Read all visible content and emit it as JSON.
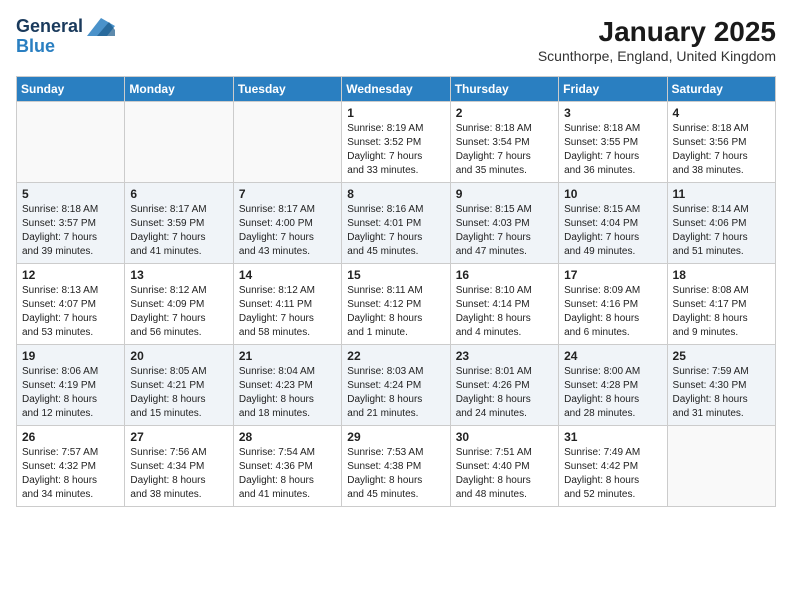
{
  "header": {
    "logo_line1": "General",
    "logo_line2": "Blue",
    "title": "January 2025",
    "subtitle": "Scunthorpe, England, United Kingdom"
  },
  "weekdays": [
    "Sunday",
    "Monday",
    "Tuesday",
    "Wednesday",
    "Thursday",
    "Friday",
    "Saturday"
  ],
  "weeks": [
    {
      "shaded": false,
      "days": [
        {
          "num": "",
          "info": ""
        },
        {
          "num": "",
          "info": ""
        },
        {
          "num": "",
          "info": ""
        },
        {
          "num": "1",
          "info": "Sunrise: 8:19 AM\nSunset: 3:52 PM\nDaylight: 7 hours\nand 33 minutes."
        },
        {
          "num": "2",
          "info": "Sunrise: 8:18 AM\nSunset: 3:54 PM\nDaylight: 7 hours\nand 35 minutes."
        },
        {
          "num": "3",
          "info": "Sunrise: 8:18 AM\nSunset: 3:55 PM\nDaylight: 7 hours\nand 36 minutes."
        },
        {
          "num": "4",
          "info": "Sunrise: 8:18 AM\nSunset: 3:56 PM\nDaylight: 7 hours\nand 38 minutes."
        }
      ]
    },
    {
      "shaded": true,
      "days": [
        {
          "num": "5",
          "info": "Sunrise: 8:18 AM\nSunset: 3:57 PM\nDaylight: 7 hours\nand 39 minutes."
        },
        {
          "num": "6",
          "info": "Sunrise: 8:17 AM\nSunset: 3:59 PM\nDaylight: 7 hours\nand 41 minutes."
        },
        {
          "num": "7",
          "info": "Sunrise: 8:17 AM\nSunset: 4:00 PM\nDaylight: 7 hours\nand 43 minutes."
        },
        {
          "num": "8",
          "info": "Sunrise: 8:16 AM\nSunset: 4:01 PM\nDaylight: 7 hours\nand 45 minutes."
        },
        {
          "num": "9",
          "info": "Sunrise: 8:15 AM\nSunset: 4:03 PM\nDaylight: 7 hours\nand 47 minutes."
        },
        {
          "num": "10",
          "info": "Sunrise: 8:15 AM\nSunset: 4:04 PM\nDaylight: 7 hours\nand 49 minutes."
        },
        {
          "num": "11",
          "info": "Sunrise: 8:14 AM\nSunset: 4:06 PM\nDaylight: 7 hours\nand 51 minutes."
        }
      ]
    },
    {
      "shaded": false,
      "days": [
        {
          "num": "12",
          "info": "Sunrise: 8:13 AM\nSunset: 4:07 PM\nDaylight: 7 hours\nand 53 minutes."
        },
        {
          "num": "13",
          "info": "Sunrise: 8:12 AM\nSunset: 4:09 PM\nDaylight: 7 hours\nand 56 minutes."
        },
        {
          "num": "14",
          "info": "Sunrise: 8:12 AM\nSunset: 4:11 PM\nDaylight: 7 hours\nand 58 minutes."
        },
        {
          "num": "15",
          "info": "Sunrise: 8:11 AM\nSunset: 4:12 PM\nDaylight: 8 hours\nand 1 minute."
        },
        {
          "num": "16",
          "info": "Sunrise: 8:10 AM\nSunset: 4:14 PM\nDaylight: 8 hours\nand 4 minutes."
        },
        {
          "num": "17",
          "info": "Sunrise: 8:09 AM\nSunset: 4:16 PM\nDaylight: 8 hours\nand 6 minutes."
        },
        {
          "num": "18",
          "info": "Sunrise: 8:08 AM\nSunset: 4:17 PM\nDaylight: 8 hours\nand 9 minutes."
        }
      ]
    },
    {
      "shaded": true,
      "days": [
        {
          "num": "19",
          "info": "Sunrise: 8:06 AM\nSunset: 4:19 PM\nDaylight: 8 hours\nand 12 minutes."
        },
        {
          "num": "20",
          "info": "Sunrise: 8:05 AM\nSunset: 4:21 PM\nDaylight: 8 hours\nand 15 minutes."
        },
        {
          "num": "21",
          "info": "Sunrise: 8:04 AM\nSunset: 4:23 PM\nDaylight: 8 hours\nand 18 minutes."
        },
        {
          "num": "22",
          "info": "Sunrise: 8:03 AM\nSunset: 4:24 PM\nDaylight: 8 hours\nand 21 minutes."
        },
        {
          "num": "23",
          "info": "Sunrise: 8:01 AM\nSunset: 4:26 PM\nDaylight: 8 hours\nand 24 minutes."
        },
        {
          "num": "24",
          "info": "Sunrise: 8:00 AM\nSunset: 4:28 PM\nDaylight: 8 hours\nand 28 minutes."
        },
        {
          "num": "25",
          "info": "Sunrise: 7:59 AM\nSunset: 4:30 PM\nDaylight: 8 hours\nand 31 minutes."
        }
      ]
    },
    {
      "shaded": false,
      "days": [
        {
          "num": "26",
          "info": "Sunrise: 7:57 AM\nSunset: 4:32 PM\nDaylight: 8 hours\nand 34 minutes."
        },
        {
          "num": "27",
          "info": "Sunrise: 7:56 AM\nSunset: 4:34 PM\nDaylight: 8 hours\nand 38 minutes."
        },
        {
          "num": "28",
          "info": "Sunrise: 7:54 AM\nSunset: 4:36 PM\nDaylight: 8 hours\nand 41 minutes."
        },
        {
          "num": "29",
          "info": "Sunrise: 7:53 AM\nSunset: 4:38 PM\nDaylight: 8 hours\nand 45 minutes."
        },
        {
          "num": "30",
          "info": "Sunrise: 7:51 AM\nSunset: 4:40 PM\nDaylight: 8 hours\nand 48 minutes."
        },
        {
          "num": "31",
          "info": "Sunrise: 7:49 AM\nSunset: 4:42 PM\nDaylight: 8 hours\nand 52 minutes."
        },
        {
          "num": "",
          "info": ""
        }
      ]
    }
  ]
}
